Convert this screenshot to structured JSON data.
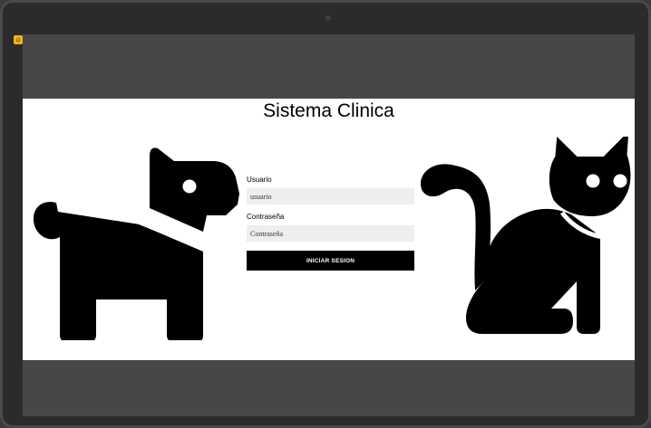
{
  "app": {
    "title": "Sistema Clinica",
    "badge_icon": "home-icon"
  },
  "login": {
    "user_label": "Usuario",
    "user_placeholder": "usuario",
    "password_label": "Contraseña",
    "password_placeholder": "Contraseña",
    "submit_label": "INICIAR SESION"
  },
  "illustrations": {
    "left": "dog-icon",
    "right": "cat-icon"
  },
  "colors": {
    "screen_background": "#474747",
    "page_background": "#ffffff",
    "button_background": "#000000",
    "input_background": "#eeeeee",
    "badge": "#f2b318"
  }
}
